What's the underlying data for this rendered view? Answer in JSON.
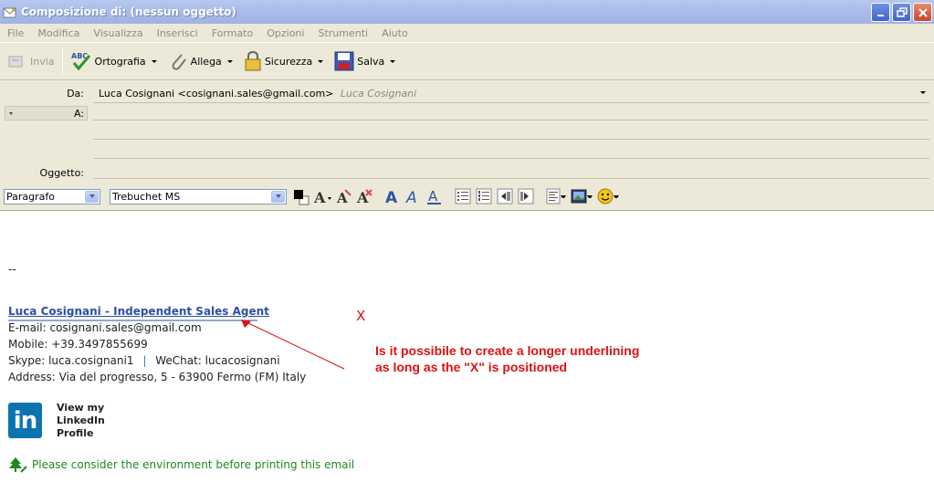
{
  "window": {
    "title": "Composizione di: (nessun oggetto)"
  },
  "menu": [
    "File",
    "Modifica",
    "Visualizza",
    "Inserisci",
    "Formato",
    "Opzioni",
    "Strumenti",
    "Aiuto"
  ],
  "toolbar": {
    "send_label": "Invia",
    "spell_label": "Ortografia",
    "attach_label": "Allega",
    "security_label": "Sicurezza",
    "save_label": "Salva"
  },
  "headers": {
    "from_label": "Da:",
    "from_value": "Luca Cosignani <cosignani.sales@gmail.com>",
    "from_identity": "Luca Cosignani",
    "to_label": "A:",
    "subject_label": "Oggetto:"
  },
  "format": {
    "paragraph_value": "Paragrafo",
    "font_value": "Trebuchet MS"
  },
  "body": {
    "separator": "--",
    "name": "Luca Cosignani - Independent Sales Agent",
    "email": "E-mail: cosignani.sales@gmail.com",
    "mobile": "Mobile: +39.3497855699",
    "skype": "Skype: luca.cosignani1",
    "divider": "|",
    "wechat": "WeChat: lucacosignani",
    "address": "Address: Via del progresso, 5 - 63900 Fermo (FM) Italy",
    "linkedin_logo": "in",
    "linkedin_line1": "View my",
    "linkedin_line2": "LinkedIn",
    "linkedin_line3": "Profile",
    "eco": "Please consider the environment before printing this email"
  },
  "annotation": {
    "marker": "X",
    "line1": "Is it possibile to create a longer underlining",
    "line2": "as long as the \"X\" is positioned"
  },
  "colors": {
    "link": "#2c4fa8",
    "annotation": "#e01010",
    "eco": "#1b8a1b",
    "linkedin": "#0c73b1"
  }
}
